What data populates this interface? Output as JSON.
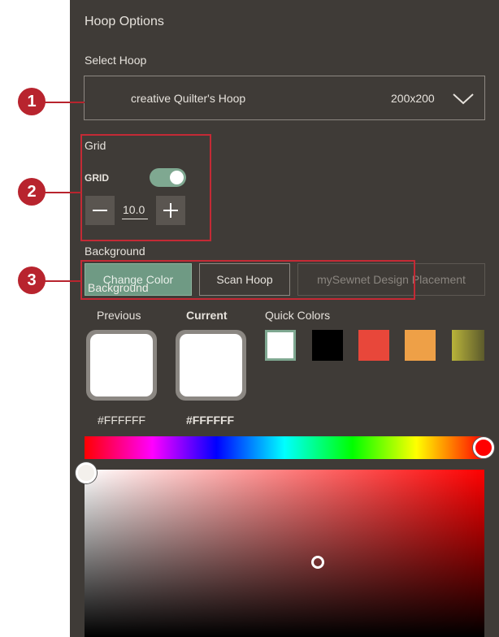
{
  "panel": {
    "title": "Hoop Options"
  },
  "hoop": {
    "section_label": "Select Hoop",
    "name": "creative Quilter's Hoop",
    "size": "200x200"
  },
  "grid": {
    "section_label": "Grid",
    "toggle_label": "GRID",
    "enabled": true,
    "value": "10.0"
  },
  "background": {
    "section_label": "Background",
    "tabs": [
      {
        "label": "Change Color",
        "active": true
      },
      {
        "label": "Scan Hoop",
        "active": false
      },
      {
        "label": "mySewnet Design Placement",
        "active": false
      }
    ],
    "tooltip": "Background"
  },
  "colors": {
    "previous_label": "Previous",
    "current_label": "Current",
    "quick_label": "Quick Colors",
    "previous_hex": "#FFFFFF",
    "current_hex": "#FFFFFF",
    "quick": [
      "#ffffff",
      "#000000",
      "#e8473a",
      "#eea047",
      "#b8b33a"
    ]
  },
  "callouts": [
    "1",
    "2",
    "3"
  ],
  "accent": {
    "callout": "#b8242e",
    "toggle": "#7fa891",
    "panel_bg": "#3f3b37"
  }
}
